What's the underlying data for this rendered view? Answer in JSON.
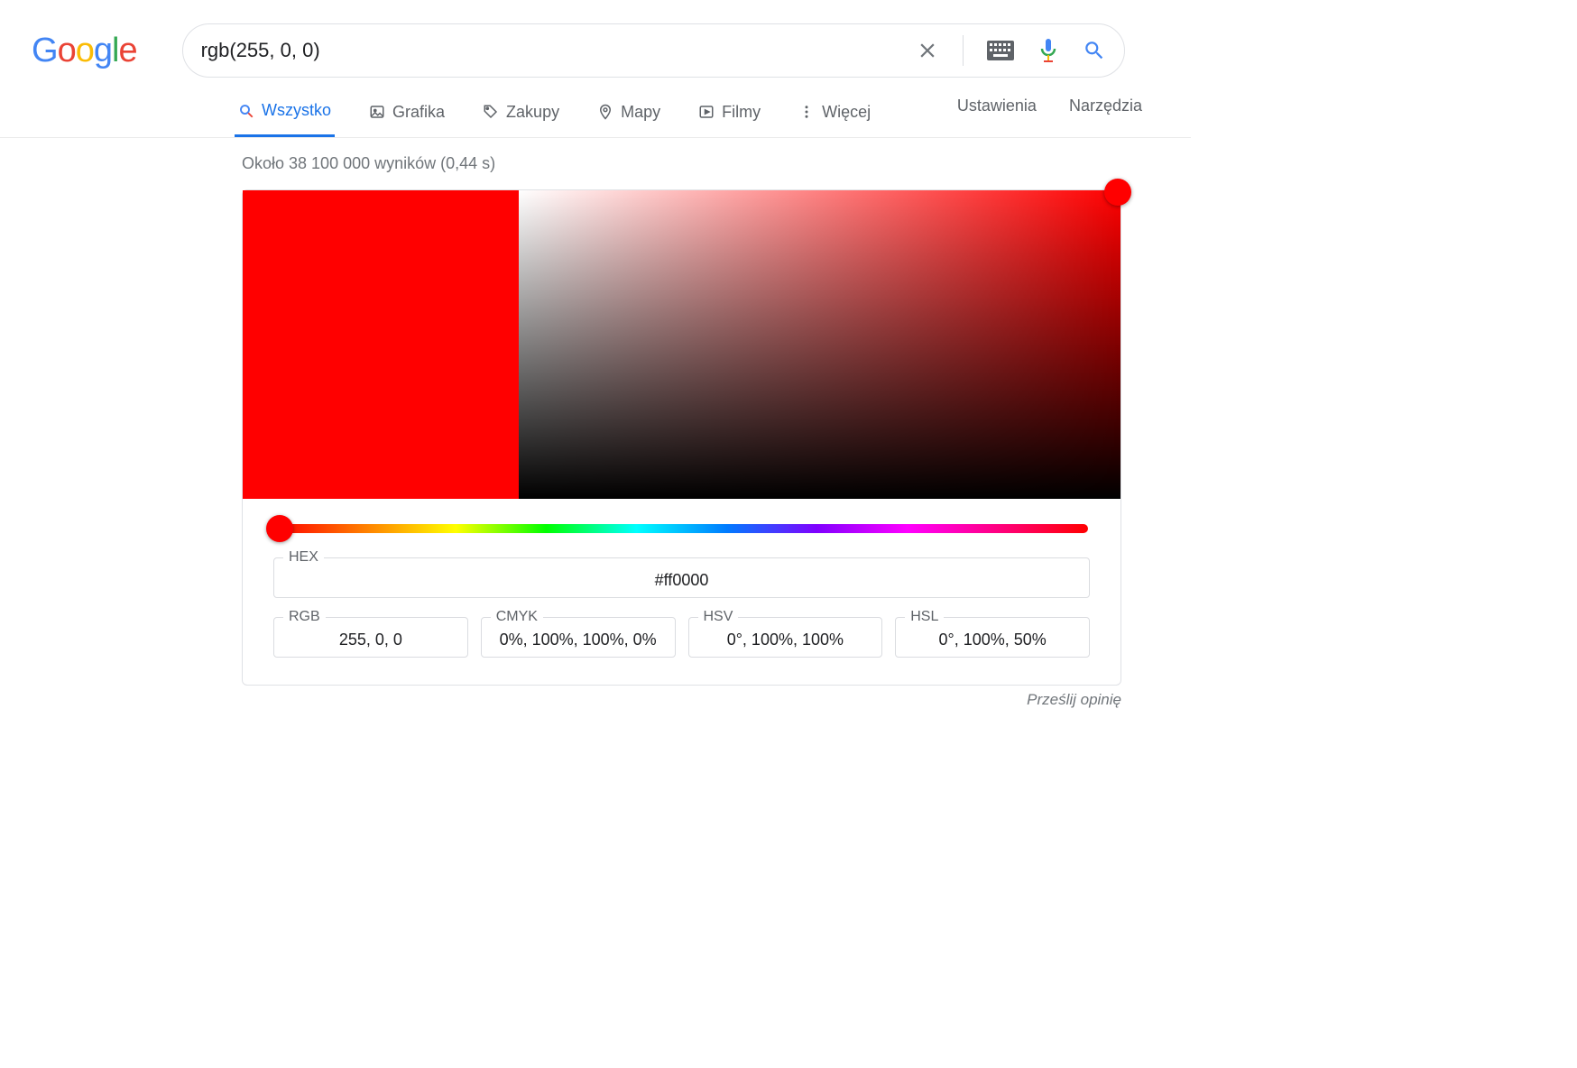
{
  "search": {
    "query": "rgb(255, 0, 0)"
  },
  "tabs": {
    "all": "Wszystko",
    "images": "Grafika",
    "shopping": "Zakupy",
    "maps": "Mapy",
    "videos": "Filmy",
    "more": "Więcej",
    "settings": "Ustawienia",
    "tools": "Narzędzia"
  },
  "stats": "Około 38 100 000 wyników (0,44 s)",
  "color": {
    "selected": "#ff0000",
    "labels": {
      "hex": "HEX",
      "rgb": "RGB",
      "cmyk": "CMYK",
      "hsv": "HSV",
      "hsl": "HSL"
    },
    "hex": "#ff0000",
    "rgb": "255, 0, 0",
    "cmyk": "0%, 100%, 100%, 0%",
    "hsv": "0°, 100%, 100%",
    "hsl": "0°, 100%, 50%"
  },
  "feedback": "Prześlij opinię"
}
